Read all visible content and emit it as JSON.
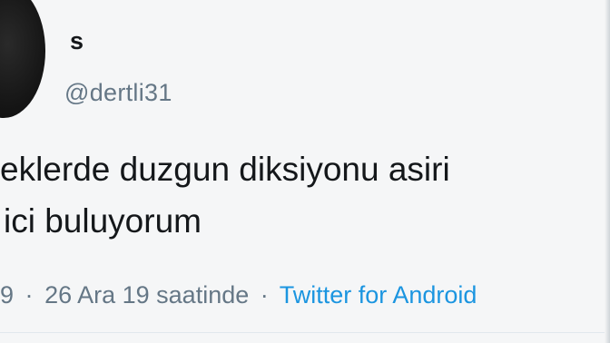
{
  "user": {
    "display_name": "s",
    "handle": "@dertli31"
  },
  "tweet": {
    "line1": "eklerde duzgun diksiyonu asiri",
    "line2": "ici buluyorum"
  },
  "meta": {
    "time_fragment": "9",
    "separator1": "·",
    "date": "26 Ara 19 saatinde",
    "separator2": "·",
    "source": "Twitter for Android"
  },
  "colors": {
    "text": "#14171a",
    "secondary": "#657786",
    "link": "#1b95e0",
    "background": "#f5f6f7"
  }
}
